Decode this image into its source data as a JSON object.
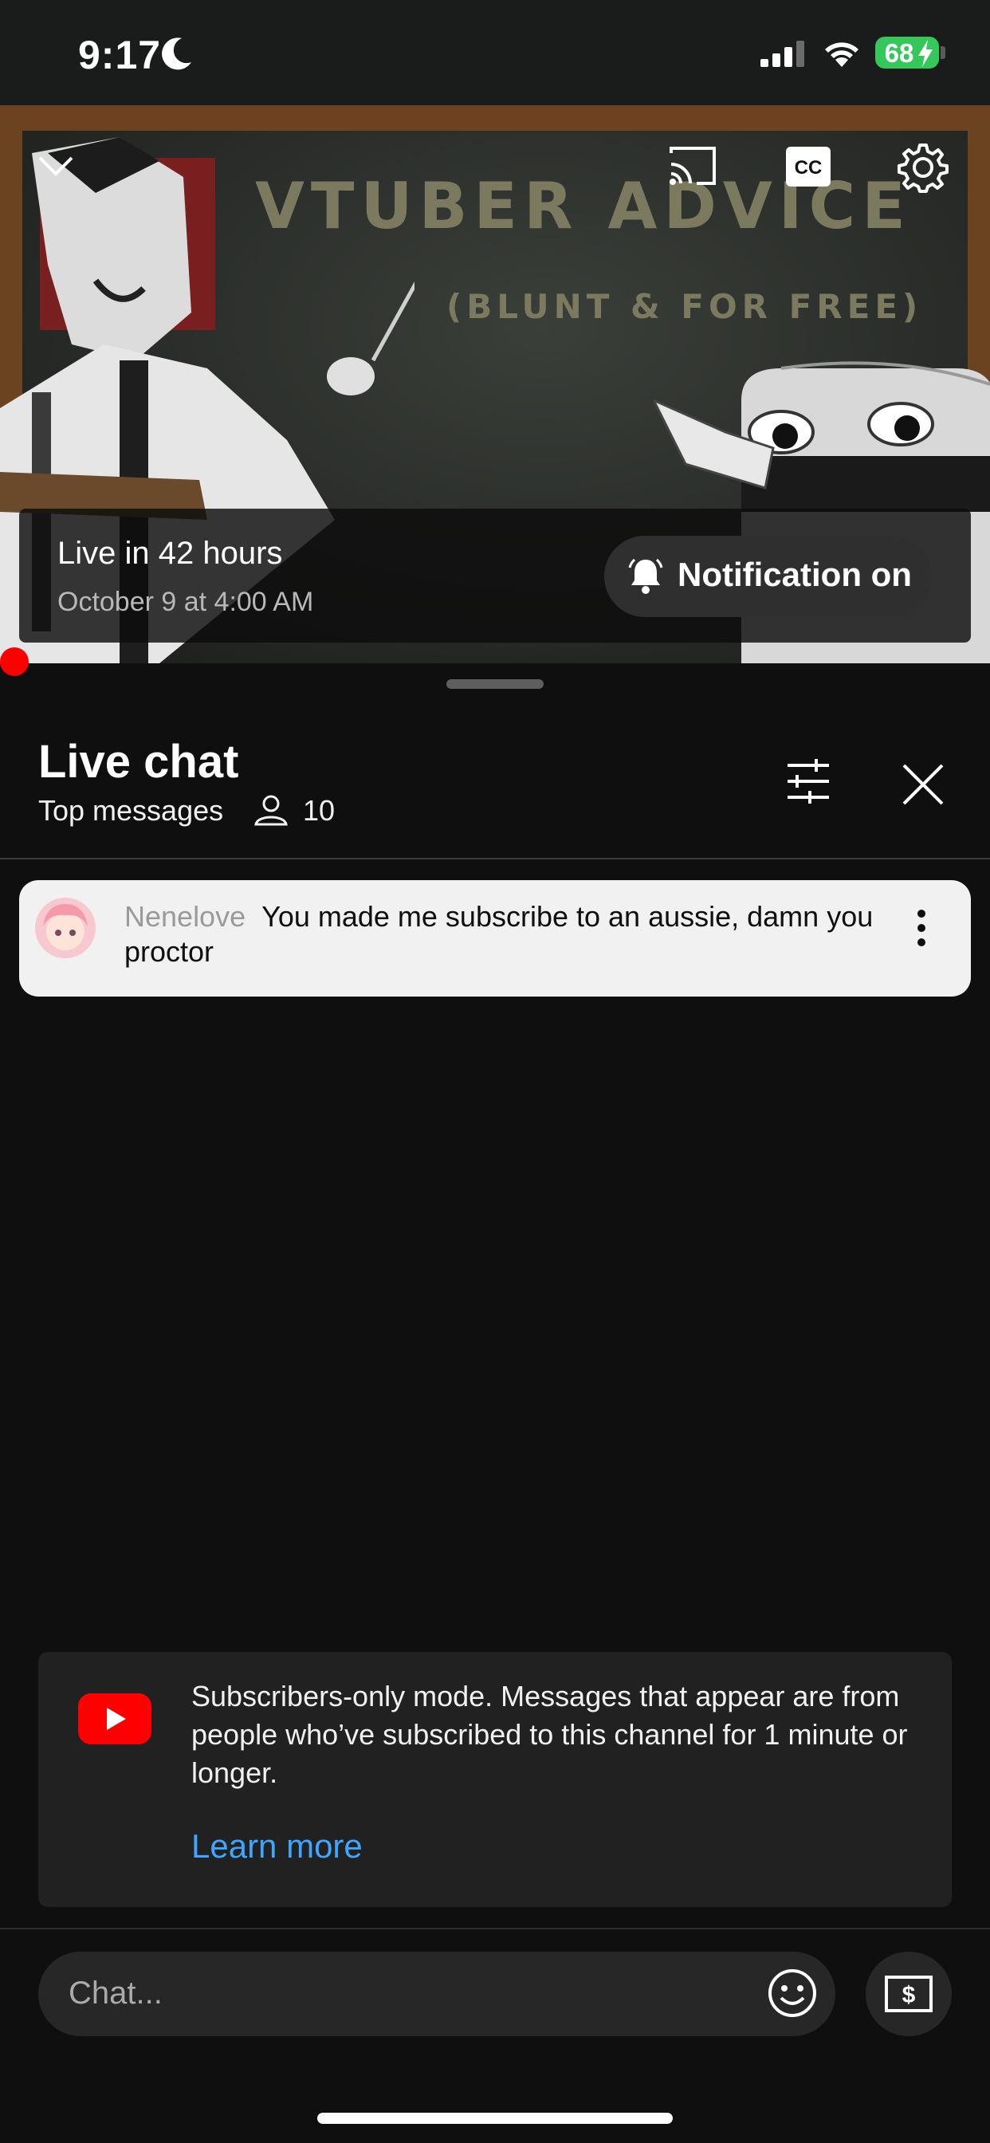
{
  "status_bar": {
    "time": "9:17",
    "battery": "68",
    "icons": [
      "moon-icon",
      "signal-icon",
      "wifi-icon",
      "battery-icon",
      "charging-bolt-icon"
    ]
  },
  "video": {
    "board_title": "VTUBER ADVICE",
    "board_subtitle": "(BLUNT & FOR FREE)",
    "live_in": "Live in 42 hours",
    "scheduled_date": "October 9 at 4:00 AM",
    "notification_label": "Notification on",
    "icons": [
      "chevron-down-icon",
      "cast-icon",
      "closed-captions-icon",
      "gear-icon",
      "bell-icon"
    ]
  },
  "chat": {
    "title": "Live chat",
    "mode": "Top messages",
    "viewer_count": "10",
    "messages": [
      {
        "author": "Nenelove",
        "text": "You made me subscribe to an aussie, damn you proctor"
      }
    ],
    "info": {
      "text": "Subscribers-only mode. Messages that appear are from people who’ve subscribed to this channel for 1 minute or longer.",
      "link": "Learn more"
    },
    "input_placeholder": "Chat..."
  },
  "colors": {
    "accent_red": "#ff0000",
    "link_blue": "#3ea6ff",
    "battery_green": "#34c759"
  }
}
